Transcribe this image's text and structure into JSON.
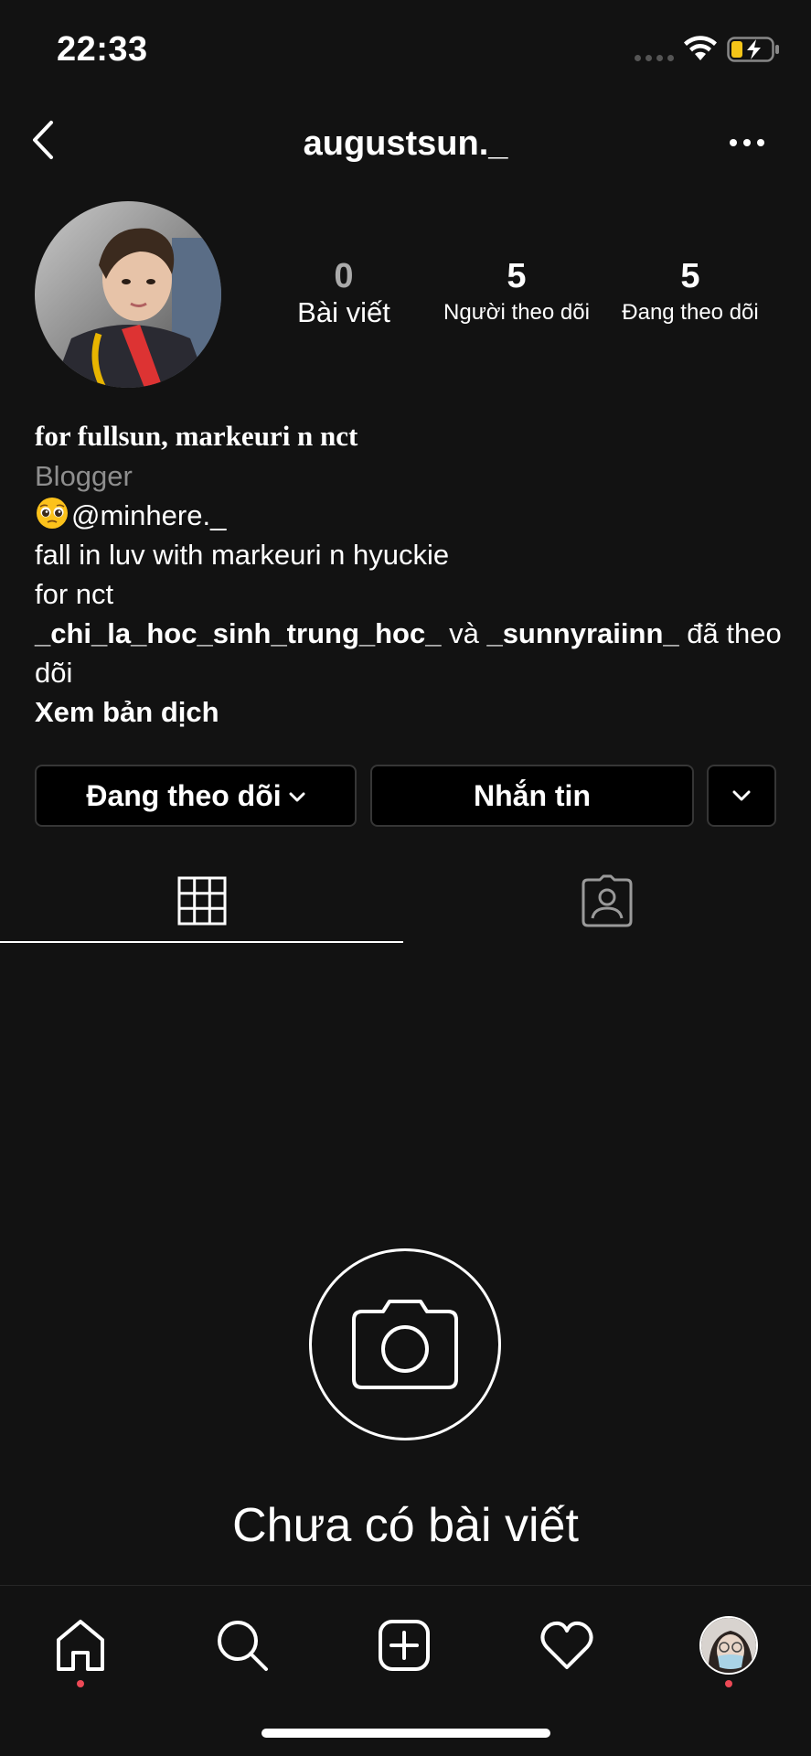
{
  "status_bar": {
    "time": "22:33"
  },
  "header": {
    "username": "augustsun._",
    "icons": {
      "back": "chevron-left-icon",
      "more": "more-dots-icon"
    }
  },
  "profile": {
    "stats": [
      {
        "value": "0",
        "label": "Bài viết"
      },
      {
        "value": "5",
        "label": "Người theo dõi"
      },
      {
        "value": "5",
        "label": "Đang theo dõi"
      }
    ],
    "bio": {
      "name": "for fullsun, markeuri n nct",
      "category": "Blogger",
      "mention": "@minhere._",
      "line1": "fall in luv with markeuri n hyuckie",
      "line2": "for nct",
      "followed_by_user1": "_chi_la_hoc_sinh_trung_hoc_",
      "followed_by_conj": " và ",
      "followed_by_user2": "_sunnyraiinn_",
      "followed_by_suffix": " đã theo dõi",
      "translate": "Xem bản dịch"
    },
    "buttons": {
      "following": "Đang theo dõi",
      "message": "Nhắn tin"
    }
  },
  "tabs": {
    "grid": "grid-icon",
    "tagged": "tagged-person-icon",
    "active": "grid"
  },
  "empty_state": {
    "text": "Chưa có bài viết",
    "icon": "camera-icon"
  },
  "bottom_nav": [
    "home-icon",
    "search-icon",
    "new-post-icon",
    "heart-icon",
    "profile-avatar"
  ],
  "colors": {
    "background": "#121212",
    "notification_dot": "#ed4956",
    "muted_text": "#8e8e8e",
    "border": "#363636"
  }
}
